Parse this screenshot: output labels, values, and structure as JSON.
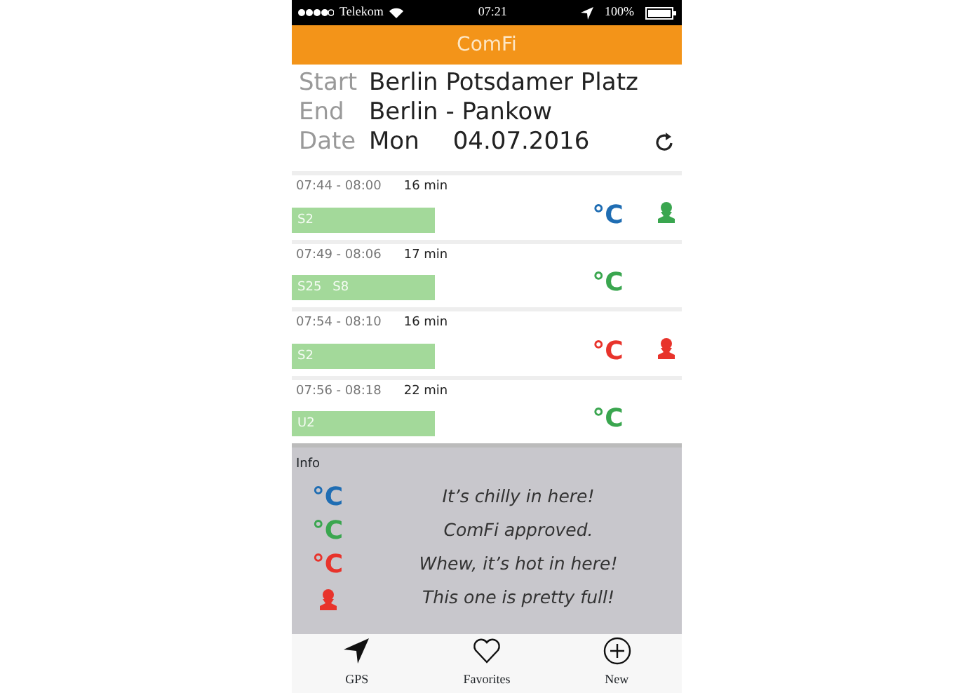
{
  "status_bar": {
    "carrier": "Telekom",
    "time": "07:21",
    "battery": "100%"
  },
  "header": {
    "title": "ComFi"
  },
  "trip": {
    "fields": [
      {
        "label": "Start",
        "value": "Berlin Potsdamer Platz"
      },
      {
        "label": "End",
        "value": "Berlin - Pankow"
      }
    ],
    "date": {
      "label": "Date",
      "weekday": "Mon",
      "value": "04.07.2016"
    }
  },
  "connections": [
    {
      "time": "07:44 - 08:00",
      "duration": "16 min",
      "lines": [
        "S2"
      ],
      "temp": {
        "symbol": "°C",
        "color": "#1f6db3"
      },
      "person": {
        "color": "#3aa64f"
      }
    },
    {
      "time": "07:49 - 08:06",
      "duration": "17 min",
      "lines": [
        "S25",
        "S8"
      ],
      "temp": {
        "symbol": "°C",
        "color": "#3aa64f"
      }
    },
    {
      "time": "07:54 - 08:10",
      "duration": "16 min",
      "lines": [
        "S2"
      ],
      "temp": {
        "symbol": "°C",
        "color": "#e8332b"
      },
      "person": {
        "color": "#e8332b"
      }
    },
    {
      "time": "07:56 - 08:18",
      "duration": "22 min",
      "lines": [
        "U2"
      ],
      "temp": {
        "symbol": "°C",
        "color": "#3aa64f"
      }
    }
  ],
  "info": {
    "title": "Info",
    "items": [
      {
        "kind": "temp",
        "symbol": "°C",
        "color": "#1f6db3",
        "text": "It’s chilly in here!"
      },
      {
        "kind": "temp",
        "symbol": "°C",
        "color": "#3aa64f",
        "text": "ComFi approved."
      },
      {
        "kind": "temp",
        "symbol": "°C",
        "color": "#e8332b",
        "text": "Whew, it’s hot in here!"
      },
      {
        "kind": "person",
        "color": "#e8332b",
        "text": "This one is pretty full!"
      }
    ]
  },
  "tab_bar": [
    {
      "kind": "gps",
      "label": "GPS"
    },
    {
      "kind": "favorites",
      "label": "Favorites"
    },
    {
      "kind": "new",
      "label": "New"
    }
  ]
}
